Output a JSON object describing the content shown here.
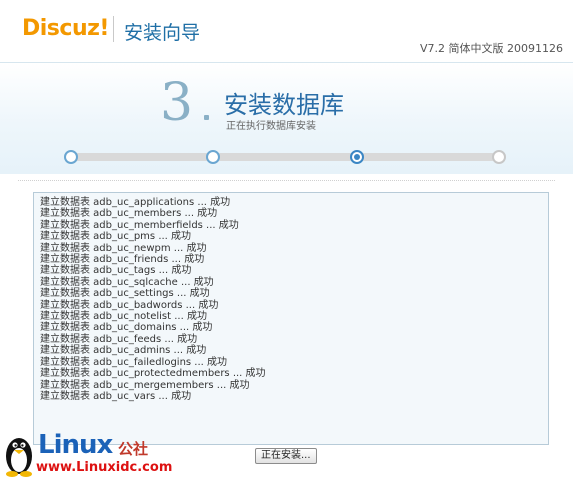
{
  "header": {
    "logo": "Discuz",
    "logo_mark": "!",
    "title": "安装向导",
    "version": "V7.2 简体中文版 20091126"
  },
  "step": {
    "number": "3",
    "title": "安装数据库",
    "subtitle": "正在执行数据库安装"
  },
  "progress": {
    "total_steps": 4,
    "current_step": 3
  },
  "log": {
    "lines": [
      "建立数据表 adb_uc_applications ... 成功",
      "建立数据表 adb_uc_members ... 成功",
      "建立数据表 adb_uc_memberfields ... 成功",
      "建立数据表 adb_uc_pms ... 成功",
      "建立数据表 adb_uc_newpm ... 成功",
      "建立数据表 adb_uc_friends ... 成功",
      "建立数据表 adb_uc_tags ... 成功",
      "建立数据表 adb_uc_sqlcache ... 成功",
      "建立数据表 adb_uc_settings ... 成功",
      "建立数据表 adb_uc_badwords ... 成功",
      "建立数据表 adb_uc_notelist ... 成功",
      "建立数据表 adb_uc_domains ... 成功",
      "建立数据表 adb_uc_feeds ... 成功",
      "建立数据表 adb_uc_admins ... 成功",
      "建立数据表 adb_uc_failedlogins ... 成功",
      "建立数据表 adb_uc_protectedmembers ... 成功",
      "建立数据表 adb_uc_mergemembers ... 成功",
      "建立数据表 adb_uc_vars ... 成功"
    ]
  },
  "button": {
    "label": "正在安装..."
  },
  "watermark": {
    "linux": "Linux",
    "cn": "公社",
    "url": "www.Linuxidc.com"
  }
}
